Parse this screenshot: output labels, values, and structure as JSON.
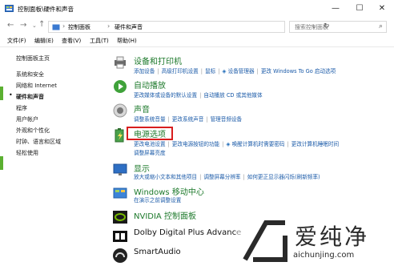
{
  "window": {
    "title": "控制面板\\硬件和声音"
  },
  "nav": {
    "breadcrumb": [
      "控制面板",
      "硬件和声音"
    ]
  },
  "search": {
    "placeholder": "搜索控制面板"
  },
  "menu": [
    "文件(F)",
    "编辑(E)",
    "查看(V)",
    "工具(T)",
    "帮助(H)"
  ],
  "sidebar": {
    "home": "控制面板主页",
    "items": [
      "系统和安全",
      "网络和 Internet",
      "硬件和声音",
      "程序",
      "用户帐户",
      "外观和个性化",
      "时钟、语言和区域",
      "轻松使用"
    ]
  },
  "categories": [
    {
      "title": "设备和打印机",
      "lines": [
        [
          "添加设备",
          "高级打印机设置",
          "鼠标",
          "设备管理器",
          "更改 Windows To Go 启动选项"
        ]
      ]
    },
    {
      "title": "自动播放",
      "lines": [
        [
          "更改媒体或设备的默认设置",
          "自动播放 CD 或其他媒体"
        ]
      ]
    },
    {
      "title": "声音",
      "lines": [
        [
          "调整系统音量",
          "更改系统声音",
          "管理音频设备"
        ]
      ]
    },
    {
      "title": "电源选项",
      "lines": [
        [
          "更改电池设置",
          "更改电源按钮的功能",
          "唤醒计算机时需要密码",
          "更改计算机睡眠时间"
        ],
        [
          "调整屏幕亮度"
        ]
      ]
    },
    {
      "title": "显示",
      "lines": [
        [
          "放大或缩小文本和其他项目",
          "调整屏幕分辨率",
          "如何更正显示器闪烁(刷新频率)"
        ]
      ]
    },
    {
      "title": "Windows 移动中心",
      "lines": [
        [
          "在演示之前调整设置"
        ]
      ]
    },
    {
      "title": "NVIDIA 控制面板",
      "lines": []
    },
    {
      "title": "Dolby Digital Plus Advance",
      "lines": []
    },
    {
      "title": "SmartAudio",
      "lines": []
    }
  ],
  "watermark": {
    "name": "爱纯净",
    "url": "aichunjing.com"
  }
}
